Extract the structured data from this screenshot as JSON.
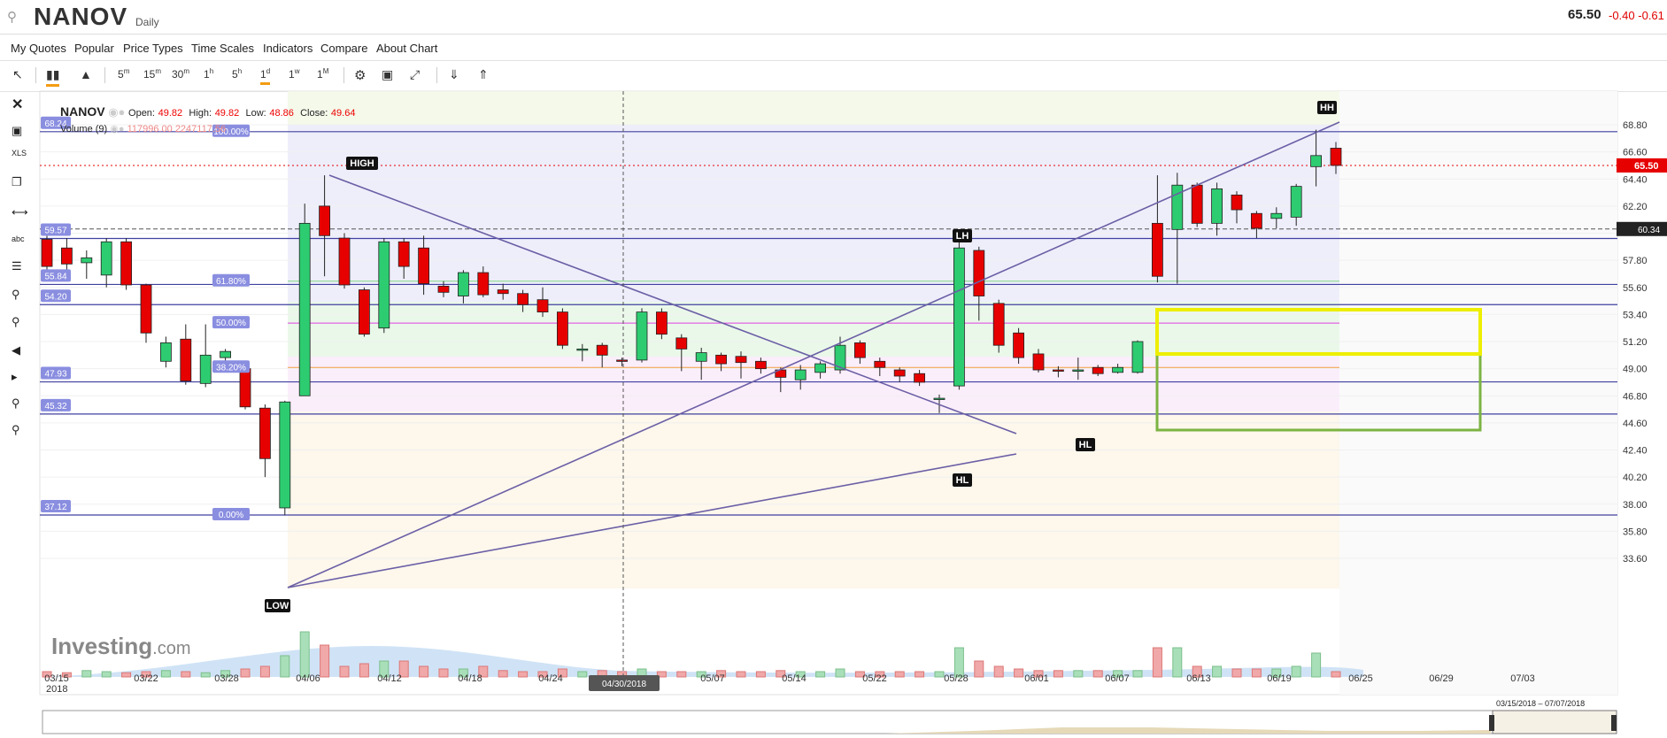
{
  "header": {
    "symbol": "NANOV",
    "interval": "Daily",
    "last_price": "65.50",
    "change": "-0.40",
    "change_pct": "-0.61"
  },
  "menu": [
    "My Quotes",
    "Popular",
    "Price Types",
    "Time Scales",
    "Indicators",
    "Compare",
    "About Chart"
  ],
  "toolbar": {
    "timeframes": [
      "5m",
      "15m",
      "30m",
      "1h",
      "5h",
      "1d",
      "1w",
      "1M"
    ],
    "active": "1d"
  },
  "legend": {
    "symbol": "NANOV",
    "open_label": "Open:",
    "open": "49.82",
    "high_label": "High:",
    "high": "49.82",
    "low_label": "Low:",
    "low": "48.86",
    "close_label": "Close:",
    "close": "49.64",
    "volume_label": "Volume (9)",
    "volume_values": "117996.00  2247117.56"
  },
  "logo": {
    "main": "Investing",
    "suffix": ".com"
  },
  "navigator": {
    "range": "03/15/2018 – 07/07/2018"
  },
  "colors": {
    "up": "#2ecc71",
    "down": "#e60000",
    "line": "#6b5fa5",
    "fib": "#4040a0"
  },
  "chart_data": {
    "type": "candlestick",
    "y_axis_ticks": [
      68.8,
      66.6,
      64.4,
      62.2,
      60.0,
      57.8,
      55.6,
      53.4,
      51.2,
      49.0,
      46.8,
      44.6,
      42.4,
      40.2,
      38.0,
      35.8,
      33.6
    ],
    "y_tick_labels": [
      "68.80",
      "66.60",
      "64.40",
      "62.20",
      "",
      "57.80",
      "55.60",
      "53.40",
      "51.20",
      "49.00",
      "46.80",
      "44.60",
      "42.40",
      "40.20",
      "38.00",
      "35.80",
      "33.60"
    ],
    "x_tick_labels": [
      "03/15",
      "03/22",
      "03/28",
      "04/06",
      "04/12",
      "04/18",
      "04/24",
      "05/07",
      "05/14",
      "05/22",
      "05/28",
      "06/01",
      "06/07",
      "06/13",
      "06/19",
      "06/25",
      "06/29",
      "07/03"
    ],
    "x_first_year": "2018",
    "crosshair_date": "04/30/2018",
    "price_flag": "65.50",
    "dashed_level_flag": "60.34",
    "fib_left_labels": [
      "68.24",
      "59.57",
      "55.84",
      "54.20",
      "47.93",
      "45.32",
      "37.12"
    ],
    "fib_pct_labels": [
      "100.00%",
      "61.80%",
      "50.00%",
      "38.20%",
      "0.00%"
    ],
    "annotations": [
      "HIGH",
      "LOW",
      "LH",
      "HL",
      "HL",
      "HH"
    ],
    "candles": [
      {
        "o": 59.5,
        "c": 57.3,
        "h": 60.2,
        "l": 56.5
      },
      {
        "o": 58.8,
        "c": 57.5,
        "h": 59.6,
        "l": 56.9
      },
      {
        "o": 57.6,
        "c": 58.0,
        "h": 58.6,
        "l": 56.3
      },
      {
        "o": 56.6,
        "c": 59.3,
        "h": 59.6,
        "l": 55.6
      },
      {
        "o": 59.3,
        "c": 55.8,
        "h": 59.6,
        "l": 55.4
      },
      {
        "o": 55.8,
        "c": 51.9,
        "h": 55.9,
        "l": 51.1
      },
      {
        "o": 49.6,
        "c": 51.1,
        "h": 51.6,
        "l": 49.1
      },
      {
        "o": 51.4,
        "c": 48.0,
        "h": 52.6,
        "l": 47.7
      },
      {
        "o": 47.8,
        "c": 50.1,
        "h": 52.6,
        "l": 47.5
      },
      {
        "o": 49.9,
        "c": 50.4,
        "h": 50.6,
        "l": 49.0
      },
      {
        "o": 49.0,
        "c": 45.9,
        "h": 49.6,
        "l": 45.7
      },
      {
        "o": 45.8,
        "c": 41.7,
        "h": 46.1,
        "l": 40.2
      },
      {
        "o": 37.7,
        "c": 46.3,
        "h": 46.4,
        "l": 37.1
      },
      {
        "o": 46.8,
        "c": 60.8,
        "h": 62.4,
        "l": 46.8
      },
      {
        "o": 62.2,
        "c": 59.8,
        "h": 64.7,
        "l": 56.5
      },
      {
        "o": 59.6,
        "c": 55.8,
        "h": 60.0,
        "l": 55.5
      },
      {
        "o": 55.4,
        "c": 51.8,
        "h": 55.6,
        "l": 51.6
      },
      {
        "o": 52.3,
        "c": 59.3,
        "h": 59.6,
        "l": 51.9
      },
      {
        "o": 59.3,
        "c": 57.3,
        "h": 59.6,
        "l": 56.3
      },
      {
        "o": 58.8,
        "c": 55.9,
        "h": 59.8,
        "l": 55.0
      },
      {
        "o": 55.7,
        "c": 55.2,
        "h": 56.1,
        "l": 54.8
      },
      {
        "o": 54.9,
        "c": 56.8,
        "h": 57.0,
        "l": 54.3
      },
      {
        "o": 56.8,
        "c": 55.0,
        "h": 57.3,
        "l": 54.8
      },
      {
        "o": 55.4,
        "c": 55.1,
        "h": 55.9,
        "l": 54.6
      },
      {
        "o": 55.1,
        "c": 54.2,
        "h": 55.4,
        "l": 53.6
      },
      {
        "o": 54.6,
        "c": 53.6,
        "h": 55.6,
        "l": 53.2
      },
      {
        "o": 53.6,
        "c": 50.9,
        "h": 53.9,
        "l": 50.6
      },
      {
        "o": 50.5,
        "c": 50.6,
        "h": 51.0,
        "l": 49.6
      },
      {
        "o": 50.9,
        "c": 50.1,
        "h": 51.1,
        "l": 49.1
      },
      {
        "o": 49.7,
        "c": 49.6,
        "h": 49.9,
        "l": 49.2
      },
      {
        "o": 49.7,
        "c": 53.6,
        "h": 53.9,
        "l": 49.5
      },
      {
        "o": 53.6,
        "c": 51.8,
        "h": 53.9,
        "l": 51.4
      },
      {
        "o": 51.5,
        "c": 50.6,
        "h": 51.8,
        "l": 48.8
      },
      {
        "o": 49.6,
        "c": 50.3,
        "h": 50.7,
        "l": 48.1
      },
      {
        "o": 50.1,
        "c": 49.4,
        "h": 50.3,
        "l": 48.8
      },
      {
        "o": 50.0,
        "c": 49.5,
        "h": 50.4,
        "l": 48.2
      },
      {
        "o": 49.6,
        "c": 49.0,
        "h": 49.9,
        "l": 48.6
      },
      {
        "o": 48.9,
        "c": 48.3,
        "h": 49.1,
        "l": 47.1
      },
      {
        "o": 48.1,
        "c": 48.9,
        "h": 49.3,
        "l": 47.3
      },
      {
        "o": 48.7,
        "c": 49.4,
        "h": 49.6,
        "l": 48.2
      },
      {
        "o": 48.9,
        "c": 50.9,
        "h": 51.6,
        "l": 48.6
      },
      {
        "o": 51.1,
        "c": 49.9,
        "h": 51.3,
        "l": 49.4
      },
      {
        "o": 49.6,
        "c": 49.1,
        "h": 49.9,
        "l": 48.4
      },
      {
        "o": 48.9,
        "c": 48.4,
        "h": 49.1,
        "l": 47.9
      },
      {
        "o": 48.6,
        "c": 47.9,
        "h": 48.9,
        "l": 47.6
      },
      {
        "o": 46.5,
        "c": 46.6,
        "h": 46.9,
        "l": 45.4
      },
      {
        "o": 47.6,
        "c": 58.8,
        "h": 59.6,
        "l": 47.3
      },
      {
        "o": 58.6,
        "c": 54.9,
        "h": 58.9,
        "l": 52.9
      },
      {
        "o": 54.3,
        "c": 50.9,
        "h": 54.6,
        "l": 50.3
      },
      {
        "o": 51.9,
        "c": 49.9,
        "h": 52.3,
        "l": 49.4
      },
      {
        "o": 50.2,
        "c": 48.9,
        "h": 50.6,
        "l": 48.7
      },
      {
        "o": 48.9,
        "c": 48.8,
        "h": 49.2,
        "l": 48.3
      },
      {
        "o": 48.8,
        "c": 48.9,
        "h": 49.9,
        "l": 48.1
      },
      {
        "o": 49.1,
        "c": 48.6,
        "h": 49.3,
        "l": 48.4
      },
      {
        "o": 48.7,
        "c": 49.1,
        "h": 49.4,
        "l": 48.6
      },
      {
        "o": 48.7,
        "c": 51.2,
        "h": 51.3,
        "l": 48.6
      },
      {
        "o": 60.8,
        "c": 56.5,
        "h": 64.7,
        "l": 56.0
      },
      {
        "o": 60.3,
        "c": 63.9,
        "h": 64.9,
        "l": 55.9
      },
      {
        "o": 63.9,
        "c": 60.8,
        "h": 64.1,
        "l": 60.5
      },
      {
        "o": 60.8,
        "c": 63.6,
        "h": 64.1,
        "l": 59.8
      },
      {
        "o": 63.1,
        "c": 61.9,
        "h": 63.4,
        "l": 60.8
      },
      {
        "o": 61.6,
        "c": 60.4,
        "h": 61.8,
        "l": 59.6
      },
      {
        "o": 61.2,
        "c": 61.6,
        "h": 62.1,
        "l": 60.4
      },
      {
        "o": 61.3,
        "c": 63.8,
        "h": 64.0,
        "l": 60.6
      },
      {
        "o": 65.4,
        "c": 66.3,
        "h": 68.4,
        "l": 63.8
      },
      {
        "o": 66.9,
        "c": 65.5,
        "h": 67.4,
        "l": 64.8
      }
    ],
    "volume": [
      0.1,
      0.08,
      0.12,
      0.1,
      0.08,
      0.1,
      0.12,
      0.1,
      0.08,
      0.12,
      0.15,
      0.2,
      0.4,
      0.85,
      0.6,
      0.2,
      0.25,
      0.3,
      0.3,
      0.2,
      0.15,
      0.15,
      0.2,
      0.12,
      0.1,
      0.1,
      0.15,
      0.1,
      0.12,
      0.1,
      0.15,
      0.1,
      0.1,
      0.1,
      0.12,
      0.1,
      0.1,
      0.12,
      0.1,
      0.1,
      0.15,
      0.1,
      0.1,
      0.1,
      0.1,
      0.1,
      0.55,
      0.3,
      0.2,
      0.15,
      0.12,
      0.12,
      0.12,
      0.12,
      0.12,
      0.12,
      0.55,
      0.55,
      0.2,
      0.2,
      0.15,
      0.15,
      0.15,
      0.2,
      0.45,
      0.1
    ]
  }
}
